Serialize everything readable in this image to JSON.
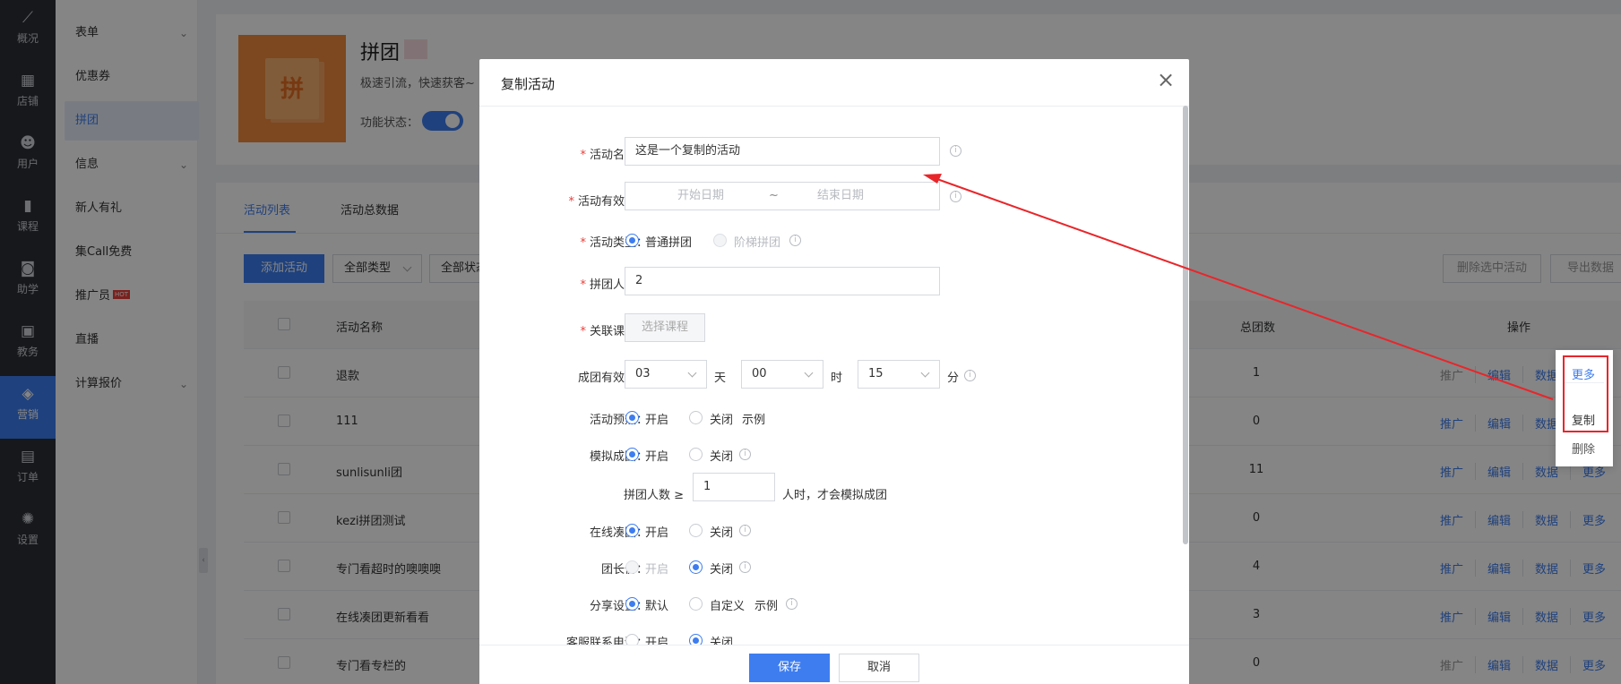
{
  "leftnav": {
    "items": [
      {
        "label": "概况",
        "icon": "chart-icon",
        "glyph": "⟋"
      },
      {
        "label": "店铺",
        "icon": "shop-icon",
        "glyph": "▦"
      },
      {
        "label": "用户",
        "icon": "user-icon",
        "glyph": "☻"
      },
      {
        "label": "课程",
        "icon": "book-icon",
        "glyph": "▮"
      },
      {
        "label": "助学",
        "icon": "gamepad-icon",
        "glyph": "◙"
      },
      {
        "label": "教务",
        "icon": "board-icon",
        "glyph": "▣"
      },
      {
        "label": "营销",
        "icon": "tag-icon",
        "glyph": "◈"
      },
      {
        "label": "订单",
        "icon": "document-icon",
        "glyph": "▤"
      },
      {
        "label": "设置",
        "icon": "gear-icon",
        "glyph": "✺"
      }
    ],
    "active_index": 6
  },
  "submenu": {
    "items": [
      {
        "label": "表单",
        "chevron": true
      },
      {
        "label": "优惠券",
        "chevron": false
      },
      {
        "label": "拼团",
        "chevron": false,
        "active": true
      },
      {
        "label": "信息",
        "chevron": true
      },
      {
        "label": "新人有礼",
        "chevron": false
      },
      {
        "label": "集Call免费",
        "chevron": false
      },
      {
        "label": "推广员",
        "chevron": false,
        "badge": "HOT"
      },
      {
        "label": "直播",
        "chevron": false
      },
      {
        "label": "计算报价",
        "chevron": true
      }
    ],
    "collapse_glyph": "‹"
  },
  "header": {
    "logo_char": "拼",
    "title": "拼团",
    "desc": "极速引流，快速获客~",
    "status_label": "功能状态："
  },
  "tabs": [
    {
      "label": "活动列表",
      "active": true
    },
    {
      "label": "活动总数据",
      "active": false
    }
  ],
  "toolbar": {
    "add_label": "添加活动",
    "type_filter": "全部类型",
    "status_filter": "全部状态",
    "delete_selected": "删除选中活动",
    "export_data": "导出数据"
  },
  "table": {
    "headers": {
      "name": "活动名称",
      "total": "总团数",
      "ops": "操作"
    },
    "op_labels": [
      "推广",
      "编辑",
      "数据",
      "更多"
    ],
    "rows": [
      {
        "name": "退款",
        "total": "1",
        "promo_disabled": true
      },
      {
        "name": "111",
        "total": "0",
        "promo_disabled": false
      },
      {
        "name": "sunlisunli团",
        "total": "11",
        "promo_disabled": false
      },
      {
        "name": "kezi拼团测试",
        "total": "0",
        "promo_disabled": false
      },
      {
        "name": "专门看超时的噢噢噢",
        "total": "4",
        "promo_disabled": false
      },
      {
        "name": "在线凑团更新看看",
        "total": "3",
        "promo_disabled": false
      },
      {
        "name": "专门看专栏的",
        "total": "0",
        "promo_disabled": true
      }
    ]
  },
  "popup": {
    "more": "更多",
    "copy": "复制",
    "delete": "删除"
  },
  "modal": {
    "title": "复制活动",
    "close_glyph": "×",
    "name_label": "活动名称：",
    "name_value": "这是一个复制的活动",
    "period_label": "活动有效期：",
    "start_placeholder": "开始日期",
    "tilde": "~",
    "end_placeholder": "结束日期",
    "type_label": "活动类型：",
    "type_normal": "普通拼团",
    "type_ladder": "阶梯拼团",
    "people_label": "拼团人数：",
    "people_value": "2",
    "course_label": "关联课程：",
    "course_button": "选择课程",
    "valid_label": "成团有效期：",
    "valid_day": "03",
    "day_unit": "天",
    "valid_hour": "00",
    "hour_unit": "时",
    "valid_min": "15",
    "min_unit": "分",
    "preheat_label": "活动预热：",
    "on": "开启",
    "off": "关闭",
    "example": "示例",
    "simulate_label": "模拟成团：",
    "simulate_people_label": "拼团人数 ≥",
    "simulate_people_value": "1",
    "simulate_suffix": "人时，才会模拟成团",
    "online_label": "在线凑团：",
    "leader_label": "团长价：",
    "share_label": "分享设置：",
    "share_default": "默认",
    "share_custom": "自定义",
    "phone_label": "客服联系电话：",
    "save": "保存",
    "cancel": "取消",
    "info_glyph": "i"
  },
  "colors": {
    "accent": "#3d7df0",
    "annotation": "#e8262a",
    "nav_bg": "#2b2f36",
    "logo_bg": "#f08a3c"
  }
}
